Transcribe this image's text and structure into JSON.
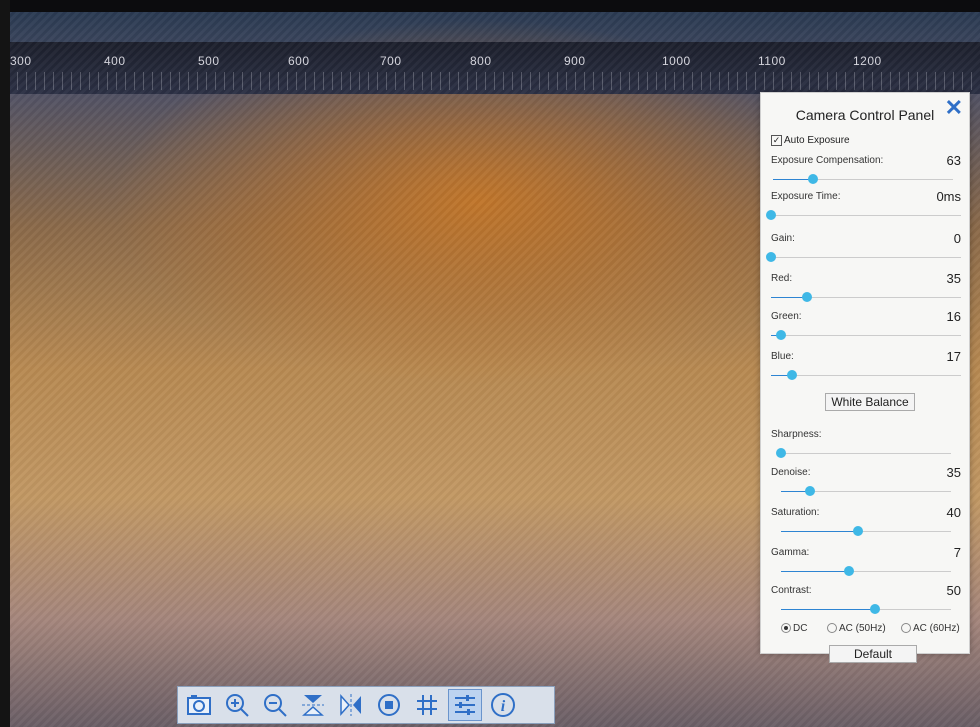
{
  "ruler": {
    "labels": [
      "300",
      "400",
      "500",
      "600",
      "700",
      "800",
      "900",
      "1000",
      "1100",
      "1200"
    ]
  },
  "panel": {
    "title": "Camera Control Panel",
    "auto_exposure": {
      "label": "Auto Exposure",
      "checked": true
    },
    "sliders": [
      {
        "key": "exposure_compensation",
        "label": "Exposure Compensation:",
        "value": "63",
        "level": 0.22
      },
      {
        "key": "exposure_time",
        "label": "Exposure Time:",
        "value": "0ms",
        "level": 0
      },
      {
        "key": "gain",
        "label": "Gain:",
        "value": "0",
        "level": 0
      },
      {
        "key": "red",
        "label": "Red:",
        "value": "35",
        "level": 0.19
      },
      {
        "key": "green",
        "label": "Green:",
        "value": "16",
        "level": 0.05
      },
      {
        "key": "blue",
        "label": "Blue:",
        "value": "17",
        "level": 0.11
      },
      {
        "key": "sharpness",
        "label": "Sharpness:",
        "value": "",
        "level": 0
      },
      {
        "key": "denoise",
        "label": "Denoise:",
        "value": "35",
        "level": 0.17
      },
      {
        "key": "saturation",
        "label": "Saturation:",
        "value": "40",
        "level": 0.45
      },
      {
        "key": "gamma",
        "label": "Gamma:",
        "value": "7",
        "level": 0.4
      },
      {
        "key": "contrast",
        "label": "Contrast:",
        "value": "50",
        "level": 0.55
      }
    ],
    "white_balance_label": "White Balance",
    "radios": [
      {
        "label": "DC",
        "selected": true
      },
      {
        "label": "AC (50Hz)",
        "selected": false
      },
      {
        "label": "AC (60Hz)",
        "selected": false
      }
    ],
    "default_label": "Default",
    "close_glyph": "✕"
  },
  "toolbar": {
    "buttons": [
      {
        "name": "snapshot-icon",
        "glyph": "📷"
      },
      {
        "name": "zoom-in-icon",
        "glyph": "⊕"
      },
      {
        "name": "zoom-out-icon",
        "glyph": "⊖"
      },
      {
        "name": "flip-vertical-icon",
        "glyph": "⇅"
      },
      {
        "name": "flip-horizontal-icon",
        "glyph": "⇄"
      },
      {
        "name": "record-stop-icon",
        "glyph": "◉"
      },
      {
        "name": "grid-icon",
        "glyph": "#"
      },
      {
        "name": "settings-sliders-icon",
        "glyph": "☰",
        "active": true
      },
      {
        "name": "info-icon",
        "glyph": "ⓘ"
      }
    ]
  },
  "colors": {
    "accent": "#3fb8e6",
    "icon": "#2f6fc7"
  }
}
